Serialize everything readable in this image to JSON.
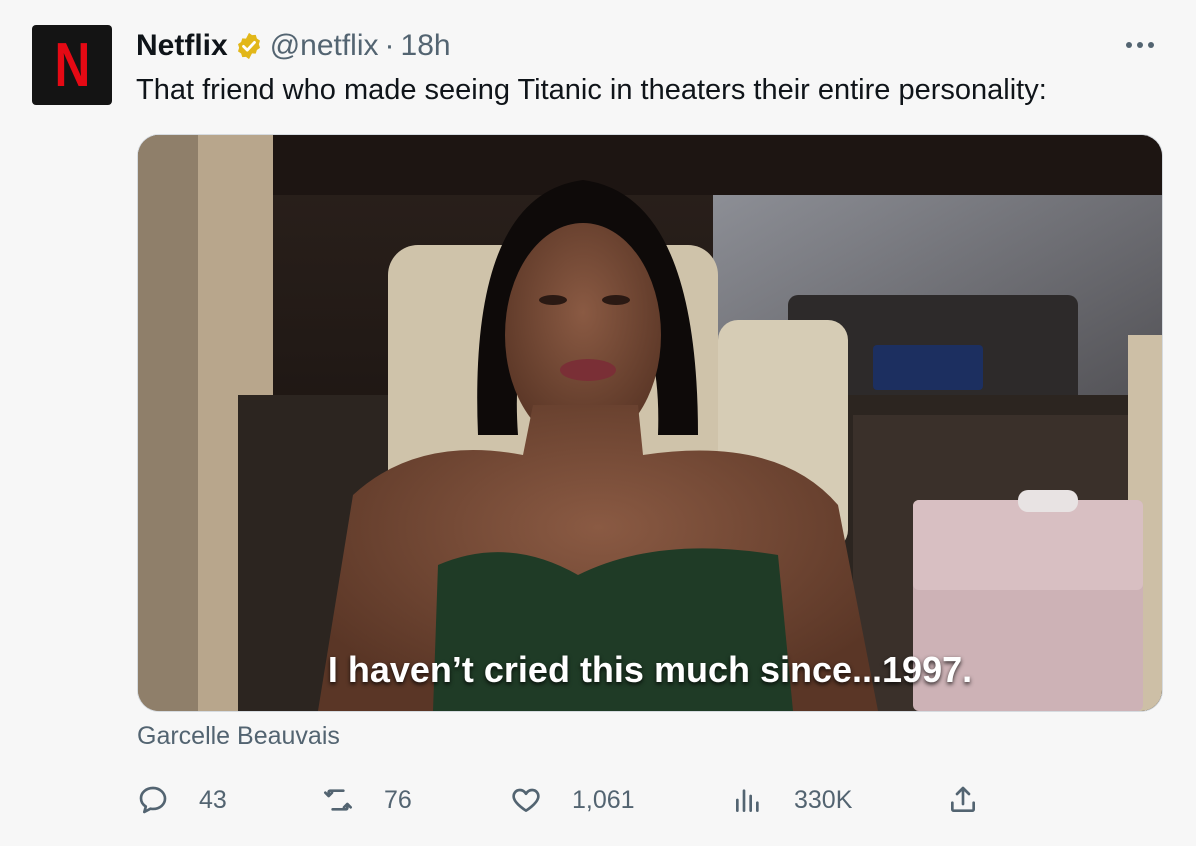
{
  "tweet": {
    "author_name": "Netflix",
    "handle": "@netflix",
    "separator": "·",
    "time": "18h",
    "text": "That friend who made seeing Titanic in theaters their entire personality:",
    "avatar_letter": "N",
    "verified_icon": "verified-badge-icon"
  },
  "media": {
    "subtitle": "I haven’t cried this much since...1997.",
    "credit": "Garcelle Beauvais"
  },
  "actions": {
    "replies": "43",
    "retweets": "76",
    "likes": "1,061",
    "views": "330K"
  },
  "colors": {
    "brand_red": "#e50914",
    "verified_gold": "#e2b719",
    "muted_text": "#536471"
  }
}
